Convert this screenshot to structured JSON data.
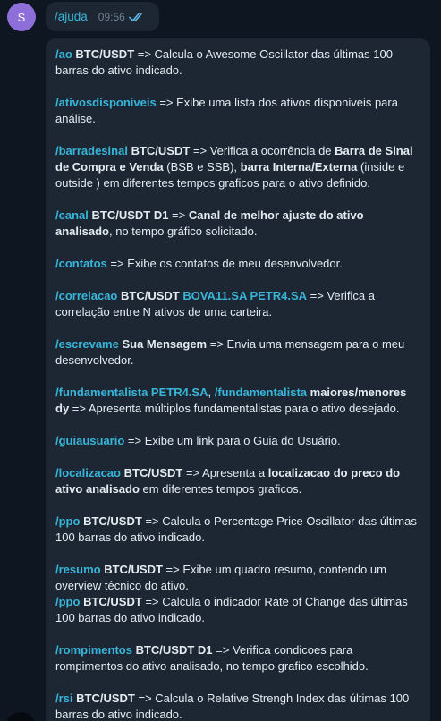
{
  "avatar": {
    "letter": "S",
    "color": "#8e6ed8"
  },
  "outgoing": {
    "text": "/ajuda",
    "time": "09:56",
    "status_icon": "double-check-icon"
  },
  "help_entries": [
    {
      "id": "ao",
      "parts": [
        {
          "t": "/ao",
          "s": "c"
        },
        {
          "t": " "
        },
        {
          "t": "BTC/USDT",
          "s": "b"
        },
        {
          "t": " => Calcula o Awesome Oscillator das últimas 100 barras do ativo indicado."
        }
      ]
    },
    {
      "id": "ativosdisponiveis",
      "parts": [
        {
          "t": "/ativosdisponiveis",
          "s": "c"
        },
        {
          "t": " => Exibe uma lista dos ativos disponiveis para análise."
        }
      ]
    },
    {
      "id": "barradesinal",
      "parts": [
        {
          "t": "/barradesinal",
          "s": "c"
        },
        {
          "t": " "
        },
        {
          "t": "BTC/USDT",
          "s": "b"
        },
        {
          "t": " => Verifica a ocorrência de "
        },
        {
          "t": "Barra de Sinal de Compra e Venda",
          "s": "b"
        },
        {
          "t": " (BSB e SSB), "
        },
        {
          "t": "barra Interna/Externa",
          "s": "b"
        },
        {
          "t": " (inside e outside ) em diferentes tempos graficos para o ativo definido."
        }
      ]
    },
    {
      "id": "canal",
      "parts": [
        {
          "t": "/canal",
          "s": "c"
        },
        {
          "t": " "
        },
        {
          "t": "BTC/USDT D1",
          "s": "b"
        },
        {
          "t": " => "
        },
        {
          "t": "Canal de melhor ajuste do ativo analisado",
          "s": "b"
        },
        {
          "t": ", no tempo gráfico solicitado."
        }
      ]
    },
    {
      "id": "contatos",
      "parts": [
        {
          "t": " "
        },
        {
          "t": "/contatos",
          "s": "c"
        },
        {
          "t": " => Exibe os contatos de meu desenvolvedor."
        }
      ]
    },
    {
      "id": "correlacao",
      "parts": [
        {
          "t": " "
        },
        {
          "t": "/correlacao",
          "s": "c"
        },
        {
          "t": " "
        },
        {
          "t": "BTC/USDT",
          "s": "b"
        },
        {
          "t": " "
        },
        {
          "t": "BOVA11.SA PETR4.SA",
          "s": "c"
        },
        {
          "t": " => Verifica a correlação entre N ativos de uma carteira."
        }
      ]
    },
    {
      "id": "escrevame",
      "parts": [
        {
          "t": "/escrevame",
          "s": "c"
        },
        {
          "t": " "
        },
        {
          "t": "Sua Mensagem",
          "s": "b"
        },
        {
          "t": " => Envia uma mensagem para o meu desenvolvedor."
        }
      ]
    },
    {
      "id": "fundamentalista",
      "parts": [
        {
          "t": "/fundamentalista PETR4.SA",
          "s": "c"
        },
        {
          "t": ", "
        },
        {
          "t": "/fundamentalista",
          "s": "c"
        },
        {
          "t": " "
        },
        {
          "t": "maiores/menores dy",
          "s": "b"
        },
        {
          "t": " => Apresenta múltiplos fundamentalistas para o ativo desejado."
        }
      ]
    },
    {
      "id": "guiausuario",
      "parts": [
        {
          "t": " "
        },
        {
          "t": "/guiausuario",
          "s": "c"
        },
        {
          "t": " => Exibe um link para o Guia do Usuário."
        }
      ]
    },
    {
      "id": "localizacao",
      "parts": [
        {
          "t": "/localizacao",
          "s": "c"
        },
        {
          "t": " "
        },
        {
          "t": "BTC/USDT",
          "s": "b"
        },
        {
          "t": " => Apresenta a "
        },
        {
          "t": "localizacao do preco do ativo analisado",
          "s": "b"
        },
        {
          "t": " em diferentes tempos graficos."
        }
      ]
    },
    {
      "id": "ppo",
      "parts": [
        {
          "t": " "
        },
        {
          "t": "/ppo",
          "s": "c"
        },
        {
          "t": " "
        },
        {
          "t": "BTC/USDT",
          "s": "b"
        },
        {
          "t": " => Calcula o Percentage Price Oscillator das últimas 100 barras do ativo indicado."
        }
      ]
    },
    {
      "id": "resumo",
      "parts": [
        {
          "t": "/resumo",
          "s": "c"
        },
        {
          "t": " "
        },
        {
          "t": "BTC/USDT",
          "s": "b"
        },
        {
          "t": " => Exibe um quadro resumo, contendo um overview técnico do ativo."
        }
      ],
      "extra": [
        {
          "t": " "
        },
        {
          "t": "/ppo",
          "s": "c"
        },
        {
          "t": "  "
        },
        {
          "t": "BTC/USDT",
          "s": "b"
        },
        {
          "t": " => Calcula o indicador Rate of Change das últimas 100 barras do ativo indicado."
        }
      ]
    },
    {
      "id": "rompimentos",
      "parts": [
        {
          "t": "/rompimentos",
          "s": "c"
        },
        {
          "t": " "
        },
        {
          "t": "BTC/USDT D1",
          "s": "b"
        },
        {
          "t": " => Verifica condicoes para rompimentos do ativo analisado, no tempo grafico escolhido."
        }
      ]
    },
    {
      "id": "rsi",
      "parts": [
        {
          "t": "/rsi",
          "s": "c"
        },
        {
          "t": " "
        },
        {
          "t": "BTC/USDT",
          "s": "b"
        },
        {
          "t": " => Calcula o Relative Strengh Index das últimas 100 barras do ativo indicado."
        }
      ]
    }
  ]
}
